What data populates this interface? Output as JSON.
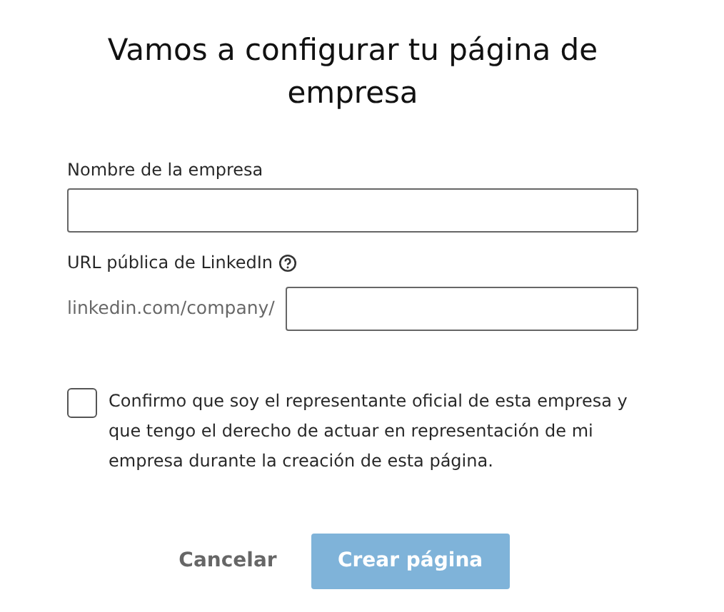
{
  "title": "Vamos a configurar tu página de empresa",
  "company_name": {
    "label": "Nombre de la empresa"
  },
  "public_url": {
    "label": "URL pública de LinkedIn",
    "prefix": "linkedin.com/company/"
  },
  "confirmation": {
    "text": "Confirmo que soy el representante oficial de esta empresa y que tengo el derecho de actuar en representación de mi empresa durante la creación de esta página.",
    "checked": false
  },
  "buttons": [
    {
      "label": "Cancelar",
      "kind": "link",
      "disabled": false
    },
    {
      "label": "Crear página",
      "kind": "primary",
      "disabled": true
    }
  ]
}
